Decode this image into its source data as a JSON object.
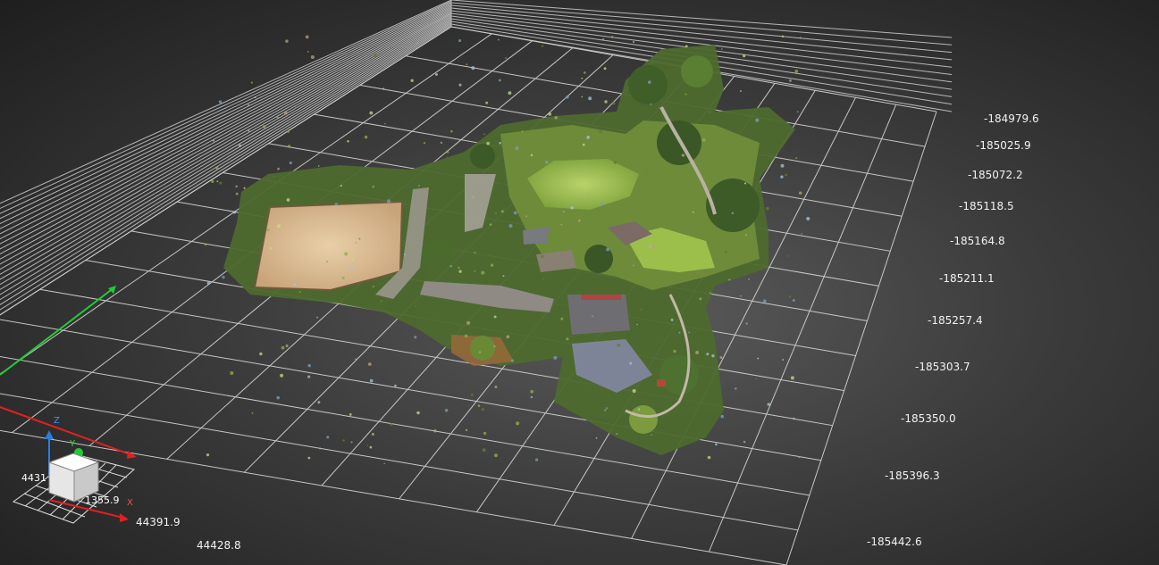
{
  "viewer": {
    "background": "#3a3a3a",
    "grid_color": "#d9d9d9",
    "axis_colors": {
      "x": "#e02020",
      "y": "#22cc33",
      "z": "#2b7de0"
    }
  },
  "y_ticks": [
    "-184979.6",
    "-185025.9",
    "-185072.2",
    "-185118.5",
    "-185164.8",
    "-185211.1",
    "-185257.4",
    "-185303.7",
    "-185350.0",
    "-185396.3",
    "-185442.6"
  ],
  "x_ticks": [
    "44391.9",
    "44428.8"
  ],
  "gizmo": {
    "z_label": "Z",
    "y_label": "Y",
    "x_label": "X",
    "value_left": "4431",
    "value_mid": "1355.9"
  }
}
